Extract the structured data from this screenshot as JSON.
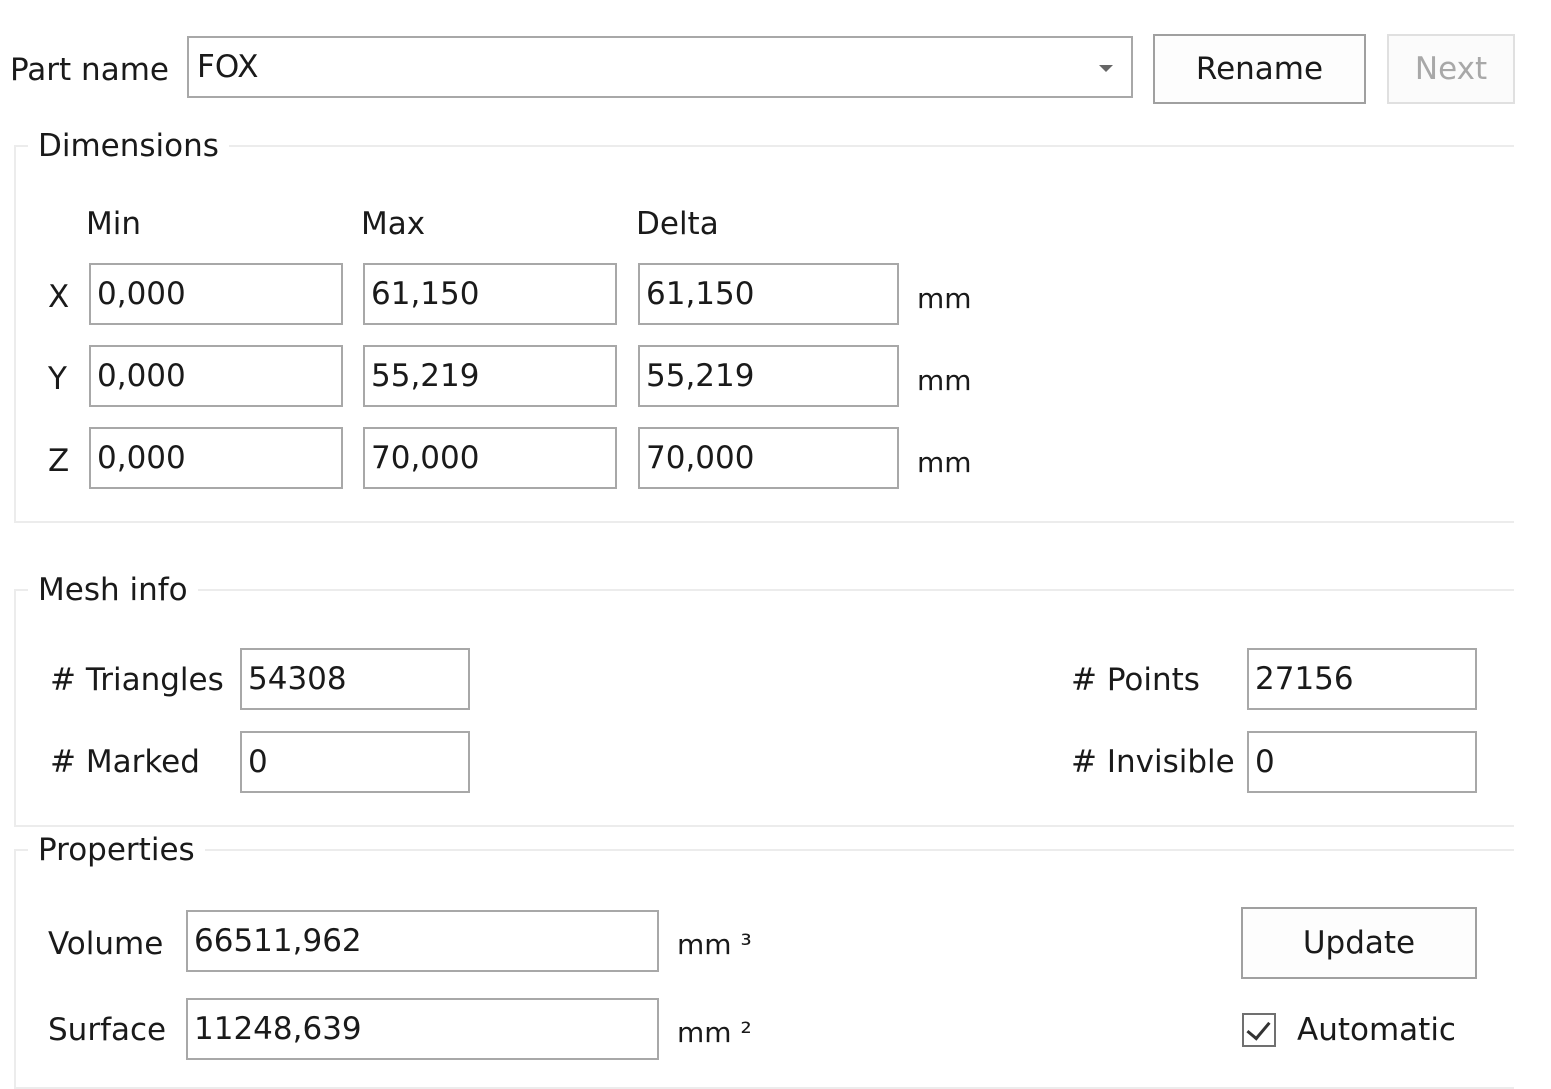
{
  "part": {
    "label": "Part name",
    "selected": "FOX",
    "rename_label": "Rename",
    "next_label": "Next"
  },
  "dimensions": {
    "title": "Dimensions",
    "headers": [
      "Min",
      "Max",
      "Delta"
    ],
    "rows": [
      {
        "axis": "X",
        "min": "0,000",
        "max": "61,150",
        "delta": "61,150",
        "unit": "mm"
      },
      {
        "axis": "Y",
        "min": "0,000",
        "max": "55,219",
        "delta": "55,219",
        "unit": "mm"
      },
      {
        "axis": "Z",
        "min": "0,000",
        "max": "70,000",
        "delta": "70,000",
        "unit": "mm"
      }
    ]
  },
  "mesh": {
    "title": "Mesh info",
    "triangles_label": "# Triangles",
    "triangles_value": "54308",
    "marked_label": "# Marked",
    "marked_value": "0",
    "points_label": "# Points",
    "points_value": "27156",
    "invisible_label": "# Invisible",
    "invisible_value": "0"
  },
  "properties": {
    "title": "Properties",
    "volume_label": "Volume",
    "volume_value": "66511,962",
    "volume_unit": "mm ³",
    "surface_label": "Surface",
    "surface_value": "11248,639",
    "surface_unit": "mm ²",
    "update_label": "Update",
    "automatic_label": "Automatic",
    "automatic_checked": true
  }
}
